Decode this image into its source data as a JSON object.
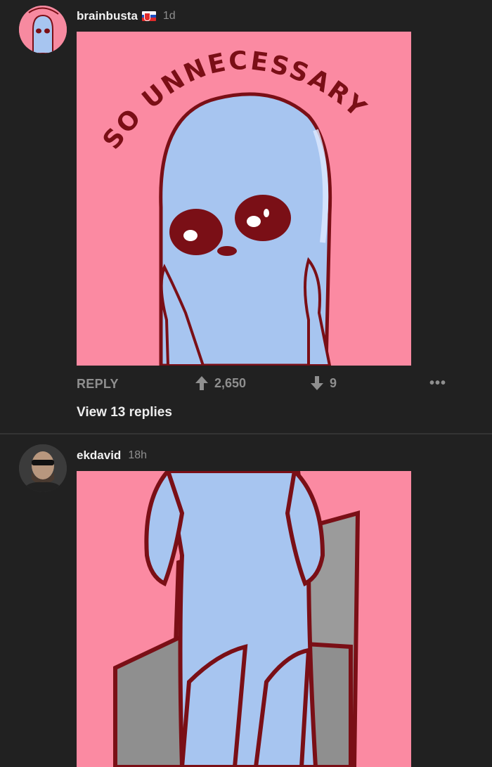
{
  "comments": [
    {
      "username": "brainbusta",
      "time": "1d",
      "image_text": "SO UNNECESSARY",
      "actions": {
        "reply_label": "REPLY",
        "upvotes": "2,650",
        "downvotes": "9",
        "more": "•••"
      },
      "view_replies": "View 13 replies"
    },
    {
      "username": "ekdavid",
      "time": "18h"
    }
  ],
  "colors": {
    "background": "#212121",
    "image_pink": "#fb8aa2",
    "alien_blue": "#a7c5f0",
    "outline_red": "#7a0f16",
    "chair_gray": "#9b9b9b"
  }
}
